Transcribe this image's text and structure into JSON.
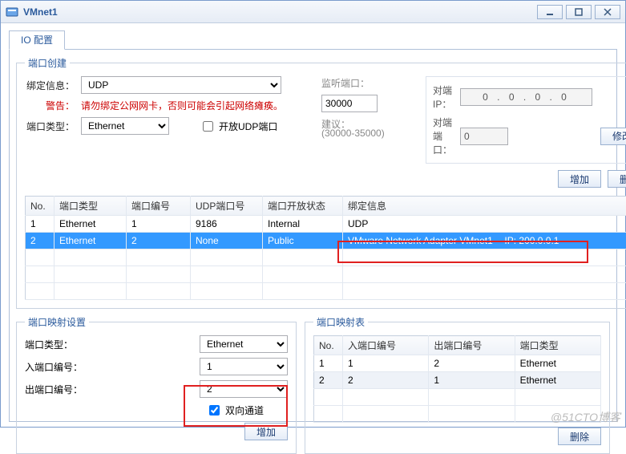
{
  "window": {
    "title": "VMnet1",
    "min": "_",
    "max": "□",
    "close": "X"
  },
  "tab": {
    "label": "IO 配置"
  },
  "port_create": {
    "legend": "端口创建",
    "bind_label": "绑定信息：",
    "bind_value": "UDP",
    "warn_label": "警告：",
    "warn_text": "请勿绑定公网网卡，否则可能会引起网络瘫痪。",
    "type_label": "端口类型：",
    "type_value": "Ethernet",
    "open_udp_label": "开放UDP端口",
    "open_udp_checked": false,
    "listen_label": "监听端口：",
    "listen_value": "30000",
    "suggest_label": "建议：",
    "suggest_range": "(30000-35000)",
    "peer_ip_label": "对端IP：",
    "peer_ip_value": "0 . 0 . 0 . 0",
    "peer_port_label": "对端端口：",
    "peer_port_value": "0",
    "btn_modify": "修改",
    "btn_add": "增加",
    "btn_del": "删除"
  },
  "port_table": {
    "headers": {
      "no": "No.",
      "type": "端口类型",
      "pno": "端口编号",
      "udp": "UDP端口号",
      "open": "端口开放状态",
      "bind": "绑定信息"
    },
    "rows": [
      {
        "no": "1",
        "type": "Ethernet",
        "pno": "1",
        "udp": "9186",
        "open": "Internal",
        "bind": "UDP"
      },
      {
        "no": "2",
        "type": "Ethernet",
        "pno": "2",
        "udp": "None",
        "open": "Public",
        "bind": "VMware Network Adapter VMnet1 -- IP: 200.0.0.1"
      }
    ]
  },
  "map_set": {
    "legend": "端口映射设置",
    "type_label": "端口类型：",
    "type_value": "Ethernet",
    "in_label": "入端口编号：",
    "in_value": "1",
    "out_label": "出端口编号：",
    "out_value": "2",
    "bidir_label": "双向通道",
    "bidir_checked": true,
    "btn_add": "增加"
  },
  "map_tbl": {
    "legend": "端口映射表",
    "headers": {
      "no": "No.",
      "in": "入端口编号",
      "out": "出端口编号",
      "type": "端口类型"
    },
    "rows": [
      {
        "no": "1",
        "in": "1",
        "out": "2",
        "type": "Ethernet"
      },
      {
        "no": "2",
        "in": "2",
        "out": "1",
        "type": "Ethernet"
      }
    ],
    "btn_del": "删除"
  },
  "watermark": "@51CTO博客"
}
